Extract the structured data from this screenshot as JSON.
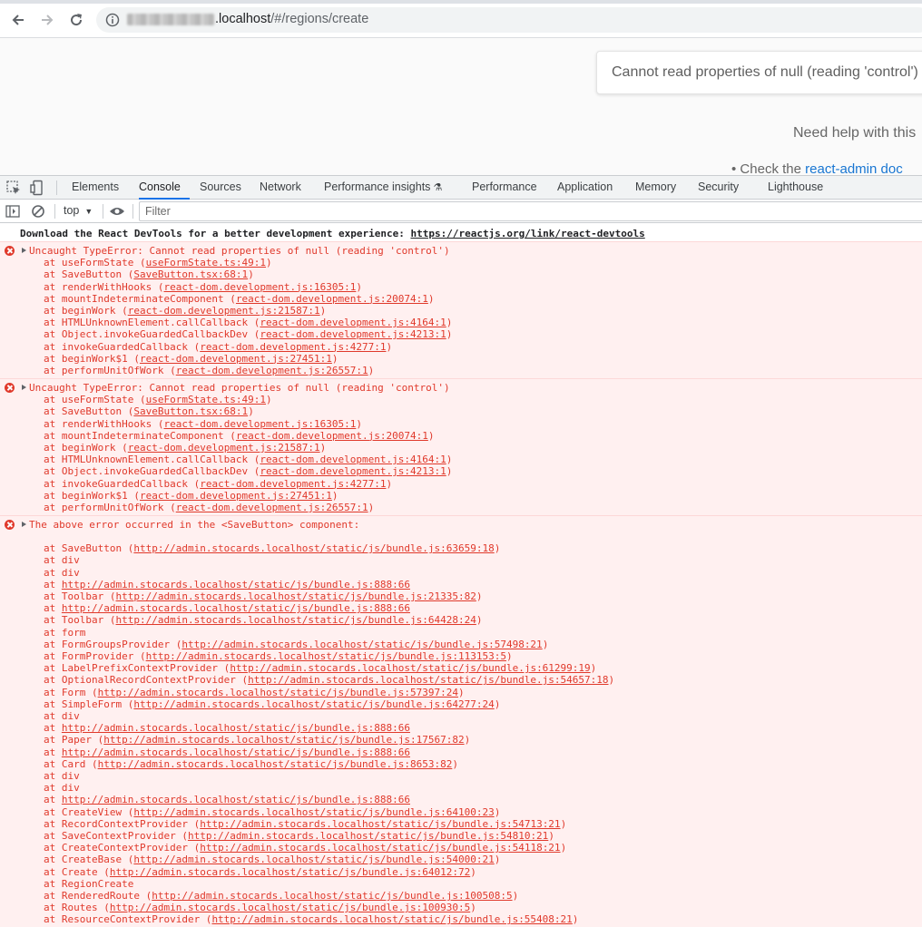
{
  "browser": {
    "url_host": ".localhost",
    "url_path": "/#/regions/create"
  },
  "page": {
    "error_card_text": "Cannot read properties of null (reading 'control')",
    "help_text": "Need help with this",
    "check_prefix": "Check the ",
    "check_link": "react-admin doc"
  },
  "devtools": {
    "tabs": [
      "Elements",
      "Console",
      "Sources",
      "Network",
      "Performance insights",
      "Performance",
      "Application",
      "Memory",
      "Security",
      "Lighthouse"
    ],
    "active_tab": "Console",
    "context": "top",
    "filter_placeholder": "Filter"
  },
  "console": {
    "info_text": "Download the React DevTools for a better development experience: ",
    "info_link": "https://reactjs.org/link/react-devtools",
    "errors": [
      {
        "message": "Uncaught TypeError: Cannot read properties of null (reading 'control')",
        "frames": [
          {
            "fn": "useFormState",
            "loc": "useFormState.ts:49:1"
          },
          {
            "fn": "SaveButton",
            "loc": "SaveButton.tsx:68:1"
          },
          {
            "fn": "renderWithHooks",
            "loc": "react-dom.development.js:16305:1"
          },
          {
            "fn": "mountIndeterminateComponent",
            "loc": "react-dom.development.js:20074:1"
          },
          {
            "fn": "beginWork",
            "loc": "react-dom.development.js:21587:1"
          },
          {
            "fn": "HTMLUnknownElement.callCallback",
            "loc": "react-dom.development.js:4164:1"
          },
          {
            "fn": "Object.invokeGuardedCallbackDev",
            "loc": "react-dom.development.js:4213:1"
          },
          {
            "fn": "invokeGuardedCallback",
            "loc": "react-dom.development.js:4277:1"
          },
          {
            "fn": "beginWork$1",
            "loc": "react-dom.development.js:27451:1"
          },
          {
            "fn": "performUnitOfWork",
            "loc": "react-dom.development.js:26557:1"
          }
        ]
      },
      {
        "message": "Uncaught TypeError: Cannot read properties of null (reading 'control')",
        "frames": [
          {
            "fn": "useFormState",
            "loc": "useFormState.ts:49:1"
          },
          {
            "fn": "SaveButton",
            "loc": "SaveButton.tsx:68:1"
          },
          {
            "fn": "renderWithHooks",
            "loc": "react-dom.development.js:16305:1"
          },
          {
            "fn": "mountIndeterminateComponent",
            "loc": "react-dom.development.js:20074:1"
          },
          {
            "fn": "beginWork",
            "loc": "react-dom.development.js:21587:1"
          },
          {
            "fn": "HTMLUnknownElement.callCallback",
            "loc": "react-dom.development.js:4164:1"
          },
          {
            "fn": "Object.invokeGuardedCallbackDev",
            "loc": "react-dom.development.js:4213:1"
          },
          {
            "fn": "invokeGuardedCallback",
            "loc": "react-dom.development.js:4277:1"
          },
          {
            "fn": "beginWork$1",
            "loc": "react-dom.development.js:27451:1"
          },
          {
            "fn": "performUnitOfWork",
            "loc": "react-dom.development.js:26557:1"
          }
        ]
      },
      {
        "message": "The above error occurred in the <SaveButton> component:",
        "frames": [
          {
            "fn": "SaveButton",
            "loc": "http://admin.stocards.localhost/static/js/bundle.js:63659:18"
          },
          {
            "fn": "div",
            "loc": ""
          },
          {
            "fn": "div",
            "loc": ""
          },
          {
            "fn": "",
            "loc": "http://admin.stocards.localhost/static/js/bundle.js:888:66"
          },
          {
            "fn": "Toolbar",
            "loc": "http://admin.stocards.localhost/static/js/bundle.js:21335:82"
          },
          {
            "fn": "",
            "loc": "http://admin.stocards.localhost/static/js/bundle.js:888:66"
          },
          {
            "fn": "Toolbar",
            "loc": "http://admin.stocards.localhost/static/js/bundle.js:64428:24"
          },
          {
            "fn": "form",
            "loc": ""
          },
          {
            "fn": "FormGroupsProvider",
            "loc": "http://admin.stocards.localhost/static/js/bundle.js:57498:21"
          },
          {
            "fn": "FormProvider",
            "loc": "http://admin.stocards.localhost/static/js/bundle.js:113153:5"
          },
          {
            "fn": "LabelPrefixContextProvider",
            "loc": "http://admin.stocards.localhost/static/js/bundle.js:61299:19"
          },
          {
            "fn": "OptionalRecordContextProvider",
            "loc": "http://admin.stocards.localhost/static/js/bundle.js:54657:18"
          },
          {
            "fn": "Form",
            "loc": "http://admin.stocards.localhost/static/js/bundle.js:57397:24"
          },
          {
            "fn": "SimpleForm",
            "loc": "http://admin.stocards.localhost/static/js/bundle.js:64277:24"
          },
          {
            "fn": "div",
            "loc": ""
          },
          {
            "fn": "",
            "loc": "http://admin.stocards.localhost/static/js/bundle.js:888:66"
          },
          {
            "fn": "Paper",
            "loc": "http://admin.stocards.localhost/static/js/bundle.js:17567:82"
          },
          {
            "fn": "",
            "loc": "http://admin.stocards.localhost/static/js/bundle.js:888:66"
          },
          {
            "fn": "Card",
            "loc": "http://admin.stocards.localhost/static/js/bundle.js:8653:82"
          },
          {
            "fn": "div",
            "loc": ""
          },
          {
            "fn": "div",
            "loc": ""
          },
          {
            "fn": "",
            "loc": "http://admin.stocards.localhost/static/js/bundle.js:888:66"
          },
          {
            "fn": "CreateView",
            "loc": "http://admin.stocards.localhost/static/js/bundle.js:64100:23"
          },
          {
            "fn": "RecordContextProvider",
            "loc": "http://admin.stocards.localhost/static/js/bundle.js:54713:21"
          },
          {
            "fn": "SaveContextProvider",
            "loc": "http://admin.stocards.localhost/static/js/bundle.js:54810:21"
          },
          {
            "fn": "CreateContextProvider",
            "loc": "http://admin.stocards.localhost/static/js/bundle.js:54118:21"
          },
          {
            "fn": "CreateBase",
            "loc": "http://admin.stocards.localhost/static/js/bundle.js:54000:21"
          },
          {
            "fn": "Create",
            "loc": "http://admin.stocards.localhost/static/js/bundle.js:64012:72"
          },
          {
            "fn": "RegionCreate",
            "loc": ""
          },
          {
            "fn": "RenderedRoute",
            "loc": "http://admin.stocards.localhost/static/js/bundle.js:100508:5"
          },
          {
            "fn": "Routes",
            "loc": "http://admin.stocards.localhost/static/js/bundle.js:100930:5"
          },
          {
            "fn": "ResourceContextProvider",
            "loc": "http://admin.stocards.localhost/static/js/bundle.js:55408:21"
          }
        ]
      }
    ]
  }
}
